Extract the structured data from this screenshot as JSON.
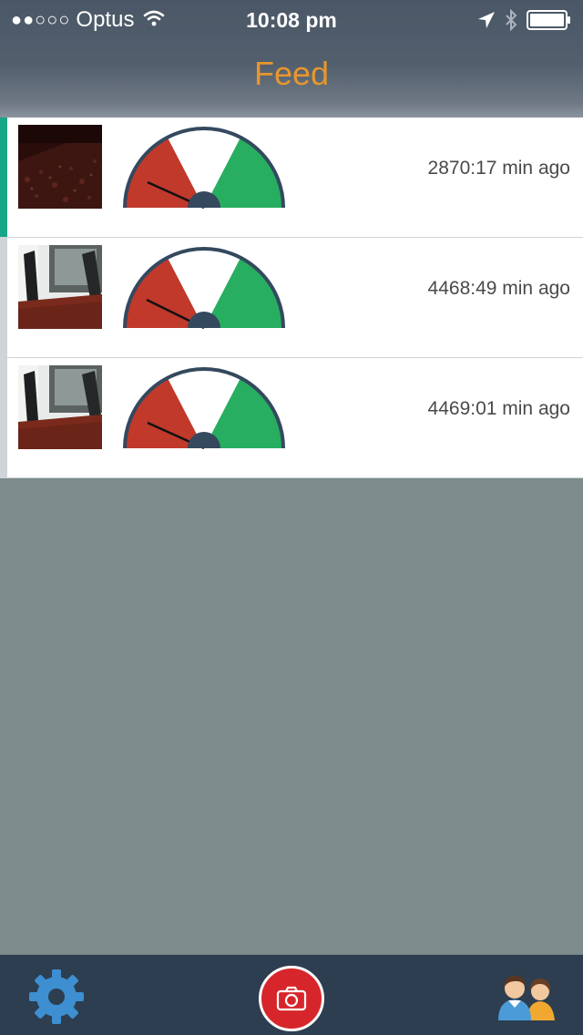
{
  "status_bar": {
    "signal_dots": "●●○○○",
    "carrier": "Optus",
    "time": "10:08 pm"
  },
  "nav": {
    "title": "Feed"
  },
  "feed": {
    "items": [
      {
        "time_ago": "2870:17 min ago",
        "selected": true,
        "thumbnail": "dark-red-carpet",
        "needle_level": 0.16
      },
      {
        "time_ago": "4468:49 min ago",
        "selected": false,
        "thumbnail": "office-table",
        "needle_level": 0.17
      },
      {
        "time_ago": "4469:01 min ago",
        "selected": false,
        "thumbnail": "office-table",
        "needle_level": 0.16
      }
    ]
  },
  "tab_bar": {
    "icons": [
      "gear-icon",
      "camera-icon",
      "people-icon"
    ]
  },
  "colors": {
    "title": "#e7962d",
    "gauge_red": "#c0392b",
    "gauge_green": "#27ae60",
    "gauge_dark": "#34495e",
    "accent_selected": "#17a786",
    "tab_bar": "#2d3e50",
    "camera": "#d7262b"
  }
}
